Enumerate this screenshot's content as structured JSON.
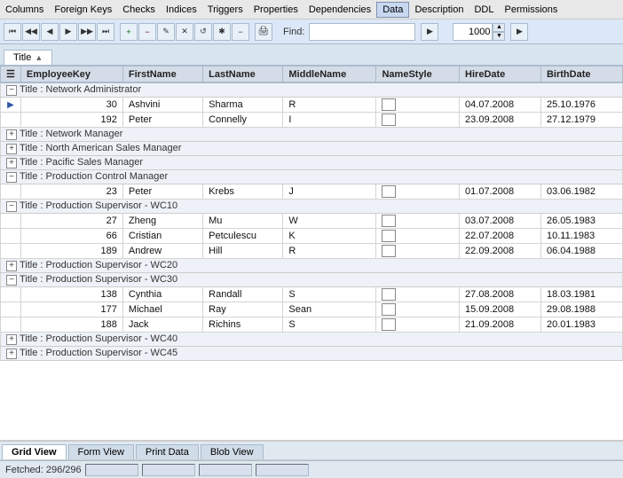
{
  "menubar": {
    "items": [
      "Columns",
      "Foreign Keys",
      "Checks",
      "Indices",
      "Triggers",
      "Properties",
      "Dependencies",
      "Data",
      "Description",
      "DDL",
      "Permissions"
    ]
  },
  "toolbar": {
    "buttons": [
      "⏮",
      "◀◀",
      "◀",
      "▶",
      "▶▶",
      "⏭",
      "+",
      "-",
      "✎",
      "✕",
      "↺",
      "*",
      "✱",
      "-"
    ],
    "find_label": "Find:",
    "find_value": "",
    "spinner_value": "1000"
  },
  "title_tab": {
    "label": "Title",
    "sort": "▲"
  },
  "columns": {
    "row_marker": "",
    "employee_key": "EmployeeKey",
    "first_name": "FirstName",
    "last_name": "LastName",
    "middle_name": "MiddleName",
    "name_style": "NameStyle",
    "hire_date": "HireDate",
    "birth_date": "BirthDate"
  },
  "groups": [
    {
      "label": "Title : Network Administrator",
      "expanded": true,
      "rows": [
        {
          "key": "30",
          "first": "Ashvini",
          "last": "Sharma",
          "middle": "R",
          "style_check": true,
          "hire": "04.07.2008",
          "birth": "25.10.1976",
          "current": true
        },
        {
          "key": "192",
          "first": "Peter",
          "last": "Connelly",
          "middle": "I",
          "style_check": true,
          "hire": "23.09.2008",
          "birth": "27.12.1979",
          "current": false
        }
      ]
    },
    {
      "label": "Title : Network Manager",
      "expanded": false,
      "rows": []
    },
    {
      "label": "Title : North American Sales Manager",
      "expanded": false,
      "rows": []
    },
    {
      "label": "Title : Pacific Sales Manager",
      "expanded": false,
      "rows": []
    },
    {
      "label": "Title : Production Control Manager",
      "expanded": true,
      "rows": [
        {
          "key": "23",
          "first": "Peter",
          "last": "Krebs",
          "middle": "J",
          "style_check": true,
          "hire": "01.07.2008",
          "birth": "03.06.1982",
          "current": false
        }
      ]
    },
    {
      "label": "Title : Production Supervisor - WC10",
      "expanded": true,
      "rows": [
        {
          "key": "27",
          "first": "Zheng",
          "last": "Mu",
          "middle": "W",
          "style_check": true,
          "hire": "03.07.2008",
          "birth": "26.05.1983",
          "current": false
        },
        {
          "key": "66",
          "first": "Cristian",
          "last": "Petculescu",
          "middle": "K",
          "style_check": true,
          "hire": "22.07.2008",
          "birth": "10.11.1983",
          "current": false
        },
        {
          "key": "189",
          "first": "Andrew",
          "last": "Hill",
          "middle": "R",
          "style_check": true,
          "hire": "22.09.2008",
          "birth": "06.04.1988",
          "current": false
        }
      ]
    },
    {
      "label": "Title : Production Supervisor - WC20",
      "expanded": false,
      "rows": []
    },
    {
      "label": "Title : Production Supervisor - WC30",
      "expanded": true,
      "rows": [
        {
          "key": "138",
          "first": "Cynthia",
          "last": "Randall",
          "middle": "S",
          "style_check": true,
          "hire": "27.08.2008",
          "birth": "18.03.1981",
          "current": false
        },
        {
          "key": "177",
          "first": "Michael",
          "last": "Ray",
          "middle": "Sean",
          "style_check": true,
          "hire": "15.09.2008",
          "birth": "29.08.1988",
          "current": false
        },
        {
          "key": "188",
          "first": "Jack",
          "last": "Richins",
          "middle": "S",
          "style_check": true,
          "hire": "21.09.2008",
          "birth": "20.01.1983",
          "current": false
        }
      ]
    },
    {
      "label": "Title : Production Supervisor - WC40",
      "expanded": false,
      "rows": []
    },
    {
      "label": "Title : Production Supervisor - WC45",
      "expanded": false,
      "rows": []
    }
  ],
  "bottom_tabs": [
    "Grid View",
    "Form View",
    "Print Data",
    "Blob View"
  ],
  "active_bottom_tab": "Grid View",
  "status": {
    "text": "Fetched: 296/296",
    "segments": [
      "",
      "",
      "",
      ""
    ]
  }
}
